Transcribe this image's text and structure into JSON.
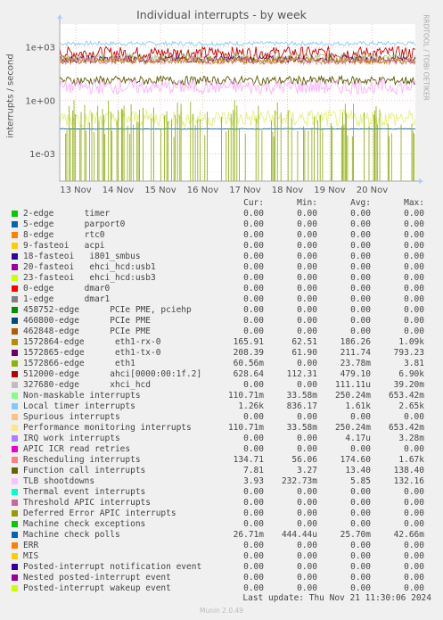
{
  "chart_data": {
    "type": "line",
    "title": "Individual interrupts - by week",
    "ylabel": "interrupts / second",
    "yscale": "log",
    "ylim": [
      3e-05,
      20000
    ],
    "yticks": [
      "1e+03",
      "1e+00",
      "1e-03"
    ],
    "x_ticks": [
      "13 Nov",
      "14 Nov",
      "15 Nov",
      "16 Nov",
      "17 Nov",
      "18 Nov",
      "19 Nov",
      "20 Nov"
    ],
    "grid": true,
    "series_levels": [
      {
        "name": "Local timer interrupts",
        "color": "#8cc8f0",
        "level": 1610,
        "spread": 0.12
      },
      {
        "name": "512000-edge ahci[0000:00:1f.2]",
        "color": "#cc0000",
        "level": 479,
        "spread": 0.35
      },
      {
        "name": "Non-maskable interrupts",
        "color": "#a0d090",
        "level": 250,
        "spread": 0.25
      },
      {
        "name": "1572865-edge eth1-tx-0",
        "color": "#6a0a6a",
        "level": 212,
        "spread": 0.2
      },
      {
        "name": "1572864-edge eth1-rx-0",
        "color": "#b08000",
        "level": 186,
        "spread": 0.2
      },
      {
        "name": "Rescheduling interrupts",
        "color": "#e08a7a",
        "level": 175,
        "spread": 0.2
      },
      {
        "name": "Function call interrupts",
        "color": "#5a5a00",
        "level": 13.4,
        "spread": 0.25
      },
      {
        "name": "TLB shootdowns",
        "color": "#ffb0ff",
        "level": 5.85,
        "spread": 0.4
      },
      {
        "name": "IRQ work interrupts",
        "color": "#e8f080",
        "level": 0.1,
        "spread": 0.5
      },
      {
        "name": "Machine check polls",
        "color": "#1060a0",
        "level": 0.0257,
        "spread": 0.02
      },
      {
        "name": "1572866-edge eth1",
        "color": "#88aa00",
        "level": 0.0238,
        "spread": 1.5
      }
    ]
  },
  "legend": {
    "headers": {
      "cur": "Cur:",
      "min": "Min:",
      "avg": "Avg:",
      "max": "Max:"
    },
    "rows": [
      {
        "label": "2-edge      timer",
        "color": "#00cc00",
        "cur": "0.00",
        "min": "0.00",
        "avg": "0.00",
        "max": "0.00"
      },
      {
        "label": "5-edge      parport0",
        "color": "#0066b3",
        "cur": "0.00",
        "min": "0.00",
        "avg": "0.00",
        "max": "0.00"
      },
      {
        "label": "8-edge      rtc0",
        "color": "#ff8000",
        "cur": "0.00",
        "min": "0.00",
        "avg": "0.00",
        "max": "0.00"
      },
      {
        "label": "9-fasteoi   acpi",
        "color": "#ffcc00",
        "cur": "0.00",
        "min": "0.00",
        "avg": "0.00",
        "max": "0.00"
      },
      {
        "label": "18-fasteoi   i801_smbus",
        "color": "#330099",
        "cur": "0.00",
        "min": "0.00",
        "avg": "0.00",
        "max": "0.00"
      },
      {
        "label": "20-fasteoi   ehci_hcd:usb1",
        "color": "#990099",
        "cur": "0.00",
        "min": "0.00",
        "avg": "0.00",
        "max": "0.00"
      },
      {
        "label": "23-fasteoi   ehci_hcd:usb3",
        "color": "#ccff00",
        "cur": "0.00",
        "min": "0.00",
        "avg": "0.00",
        "max": "0.00"
      },
      {
        "label": "0-edge      dmar0",
        "color": "#ff0000",
        "cur": "0.00",
        "min": "0.00",
        "avg": "0.00",
        "max": "0.00"
      },
      {
        "label": "1-edge      dmar1",
        "color": "#808080",
        "cur": "0.00",
        "min": "0.00",
        "avg": "0.00",
        "max": "0.00"
      },
      {
        "label": "458752-edge      PCIe PME, pciehp",
        "color": "#008f00",
        "cur": "0.00",
        "min": "0.00",
        "avg": "0.00",
        "max": "0.00"
      },
      {
        "label": "460800-edge      PCIe PME",
        "color": "#00487d",
        "cur": "0.00",
        "min": "0.00",
        "avg": "0.00",
        "max": "0.00"
      },
      {
        "label": "462848-edge      PCIe PME",
        "color": "#b35a00",
        "cur": "0.00",
        "min": "0.00",
        "avg": "0.00",
        "max": "0.00"
      },
      {
        "label": "1572864-edge      eth1-rx-0",
        "color": "#b38f00",
        "cur": "165.91",
        "min": "62.51",
        "avg": "186.26",
        "max": "1.09k"
      },
      {
        "label": "1572865-edge      eth1-tx-0",
        "color": "#6b006b",
        "cur": "208.39",
        "min": "61.90",
        "avg": "211.74",
        "max": "793.23"
      },
      {
        "label": "1572866-edge      eth1",
        "color": "#8fb300",
        "cur": "60.56m",
        "min": "0.00",
        "avg": "23.78m",
        "max": "3.81"
      },
      {
        "label": "512000-edge      ahci[0000:00:1f.2]",
        "color": "#b30000",
        "cur": "628.64",
        "min": "112.31",
        "avg": "479.10",
        "max": "6.90k"
      },
      {
        "label": "327680-edge      xhci_hcd",
        "color": "#bebebe",
        "cur": "0.00",
        "min": "0.00",
        "avg": "111.11u",
        "max": "39.20m"
      },
      {
        "label": "Non-maskable interrupts",
        "color": "#80ff80",
        "cur": "110.71m",
        "min": "33.58m",
        "avg": "250.24m",
        "max": "653.42m"
      },
      {
        "label": "Local timer interrupts",
        "color": "#80c9ff",
        "cur": "1.26k",
        "min": "836.17",
        "avg": "1.61k",
        "max": "2.65k"
      },
      {
        "label": "Spurious interrupts",
        "color": "#ffc080",
        "cur": "0.00",
        "min": "0.00",
        "avg": "0.00",
        "max": "0.00"
      },
      {
        "label": "Performance monitoring interrupts",
        "color": "#ffe680",
        "cur": "110.71m",
        "min": "33.58m",
        "avg": "250.24m",
        "max": "653.42m"
      },
      {
        "label": "IRQ work interrupts",
        "color": "#aa80ff",
        "cur": "0.00",
        "min": "0.00",
        "avg": "4.17u",
        "max": "3.28m"
      },
      {
        "label": "APIC ICR read retries",
        "color": "#ee00cc",
        "cur": "0.00",
        "min": "0.00",
        "avg": "0.00",
        "max": "0.00"
      },
      {
        "label": "Rescheduling interrupts",
        "color": "#ff8080",
        "cur": "134.71",
        "min": "56.06",
        "avg": "174.60",
        "max": "1.67k"
      },
      {
        "label": "Function call interrupts",
        "color": "#666600",
        "cur": "7.81",
        "min": "3.27",
        "avg": "13.40",
        "max": "138.40"
      },
      {
        "label": "TLB shootdowns",
        "color": "#ffbfff",
        "cur": "3.93",
        "min": "232.73m",
        "avg": "5.85",
        "max": "132.16"
      },
      {
        "label": "Thermal event interrupts",
        "color": "#00ffcc",
        "cur": "0.00",
        "min": "0.00",
        "avg": "0.00",
        "max": "0.00"
      },
      {
        "label": "Threshold APIC interrupts",
        "color": "#cc6699",
        "cur": "0.00",
        "min": "0.00",
        "avg": "0.00",
        "max": "0.00"
      },
      {
        "label": "Deferred Error APIC interrupts",
        "color": "#999900",
        "cur": "0.00",
        "min": "0.00",
        "avg": "0.00",
        "max": "0.00"
      },
      {
        "label": "Machine check exceptions",
        "color": "#00cc00",
        "cur": "0.00",
        "min": "0.00",
        "avg": "0.00",
        "max": "0.00"
      },
      {
        "label": "Machine check polls",
        "color": "#0066b3",
        "cur": "26.71m",
        "min": "444.44u",
        "avg": "25.70m",
        "max": "42.66m"
      },
      {
        "label": "ERR",
        "color": "#ff8000",
        "cur": "0.00",
        "min": "0.00",
        "avg": "0.00",
        "max": "0.00"
      },
      {
        "label": "MIS",
        "color": "#ffcc00",
        "cur": "0.00",
        "min": "0.00",
        "avg": "0.00",
        "max": "0.00"
      },
      {
        "label": "Posted-interrupt notification event",
        "color": "#330099",
        "cur": "0.00",
        "min": "0.00",
        "avg": "0.00",
        "max": "0.00"
      },
      {
        "label": "Nested posted-interrupt event",
        "color": "#990099",
        "cur": "0.00",
        "min": "0.00",
        "avg": "0.00",
        "max": "0.00"
      },
      {
        "label": "Posted-interrupt wakeup event",
        "color": "#ccff00",
        "cur": "0.00",
        "min": "0.00",
        "avg": "0.00",
        "max": "0.00"
      }
    ]
  },
  "footer": {
    "last_update": "Last update: Thu Nov 21 11:30:06 2024",
    "munin": "Munin 2.0.49"
  },
  "side_label": "RRDTOOL / TOBI OETIKER"
}
